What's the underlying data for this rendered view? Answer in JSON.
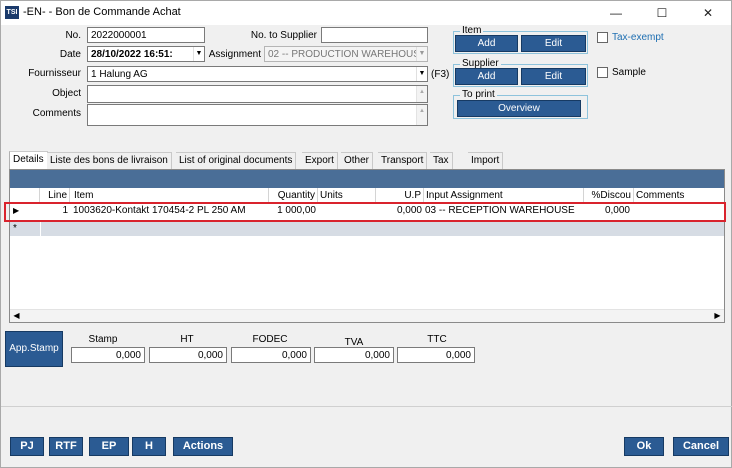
{
  "window": {
    "title": "-EN- - Bon de Commande Achat",
    "app_icon": "TSI",
    "minimize": "—",
    "maximize": "☐",
    "close": "✕"
  },
  "form": {
    "no_label": "No.",
    "no_value": "2022000001",
    "no_supplier_label": "No. to Supplier",
    "no_supplier_value": "",
    "date_label": "Date",
    "date_value": "28/10/2022 16:51:",
    "assignment_label": "Assignment",
    "assignment_value": "02 -- PRODUCTION WAREHOUSE",
    "supplier_label": "Fournisseur",
    "supplier_value": "1 Halung AG",
    "f3_hint": "(F3)",
    "object_label": "Object",
    "object_value": "",
    "comments_label": "Comments",
    "comments_value": ""
  },
  "item_group": {
    "title": "Item",
    "add": "Add",
    "edit": "Edit"
  },
  "supplier_group": {
    "title": "Supplier",
    "add": "Add",
    "edit": "Edit"
  },
  "print_group": {
    "title": "To print",
    "overview": "Overview"
  },
  "options": {
    "tax_exempt_label": "Tax-exempt",
    "tax_exempt_checked": false,
    "sample_label": "Sample",
    "sample_checked": false
  },
  "tabs": [
    {
      "label": "Details"
    },
    {
      "label": "Liste des bons de livraison"
    },
    {
      "label": "List of original documents"
    },
    {
      "label": "Export"
    },
    {
      "label": "Other"
    },
    {
      "label": "Transport"
    },
    {
      "label": "Tax"
    },
    {
      "label": "Import"
    }
  ],
  "grid": {
    "columns": [
      "Line",
      "Item",
      "Quantity",
      "Units",
      "U.P",
      "Input Assignment",
      "%Discou",
      "Comments"
    ],
    "rows": [
      {
        "line": "1",
        "item": "1003620-Kontakt 170454-2 PL 250 AM",
        "quantity": "1 000,00",
        "units": "",
        "up": "0,000",
        "assignment": "03 -- RECEPTION WAREHOUSE",
        "discount": "0,000",
        "comments": ""
      }
    ],
    "new_row_marker": "*",
    "current_row_marker": "▶"
  },
  "totals": {
    "app_stamp": "App.Stamp",
    "stamp_label": "Stamp",
    "stamp_value": "0,000",
    "ht_label": "HT",
    "ht_value": "0,000",
    "fodec_label": "FODEC",
    "fodec_value": "0,000",
    "tva_label": "TVA",
    "tva_value": "0,000",
    "ttc_label": "TTC",
    "ttc_value": "0,000"
  },
  "footer": {
    "pj": "PJ",
    "rtf": "RTF",
    "ep": "EP",
    "h": "H",
    "actions": "Actions",
    "ok": "Ok",
    "cancel": "Cancel"
  },
  "colors": {
    "button_bg": "#2b5b93",
    "grid_bar": "#4a6e97",
    "group_border": "#8ec3dc",
    "selection_outline": "#d9232d"
  }
}
